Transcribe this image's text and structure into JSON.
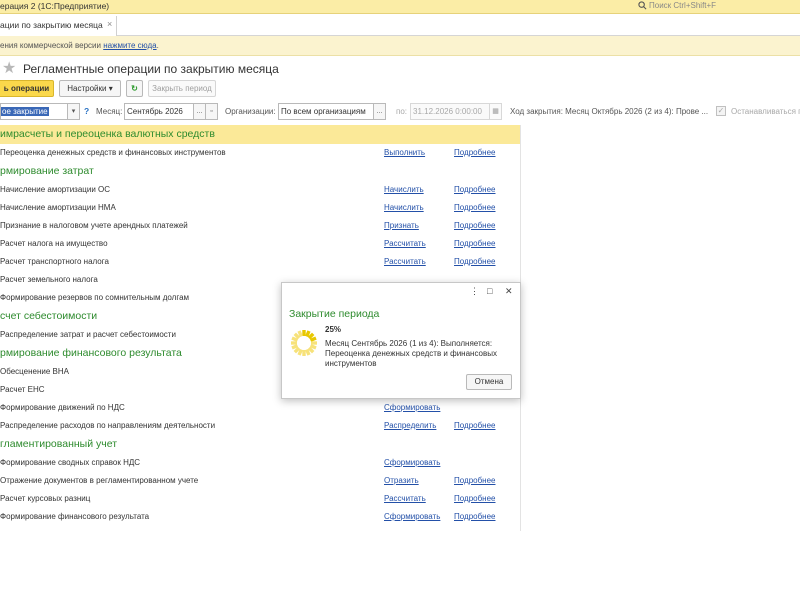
{
  "window": {
    "app_title": "ерация 2  (1С:Предприятие)",
    "search_placeholder": "Поиск Ctrl+Shift+F"
  },
  "tabs": [
    {
      "label": "ации по закрытию месяца",
      "close": "×"
    }
  ],
  "infobar": {
    "text": "ения коммерческой версии ",
    "link": "нажмите сюда",
    "suffix": "."
  },
  "form": {
    "title": "Регламентные операции по закрытию месяца"
  },
  "toolbar": {
    "primary_label": "ь операции",
    "settings_label": "Настройки",
    "settings_arrow": "▾",
    "refresh_icon": "↻",
    "close_period_label": "Закрыть период"
  },
  "filters": {
    "mode_value": "ое закрытие",
    "mode_arrow": "▾",
    "help": "?",
    "month_label": "Месяц:",
    "month_value": "Сентябрь 2026",
    "month_btn": "...",
    "month_btn2": "▫",
    "org_label": "Организации:",
    "org_value": "По всем организациям",
    "org_btn": "...",
    "to_label": "по:",
    "to_value": "31.12.2026  0:00:00",
    "to_btn": "▦",
    "progress_text": "Ход закрытия:  Месяц Октябрь 2026 (2 из 4): Прове ...",
    "stop_label": "Останавливаться при"
  },
  "groups": [
    {
      "label": "имрасчеты и переоценка валютных средств",
      "highlight": true,
      "rows": [
        {
          "label": "Переоценка денежных средств и финансовых инструментов",
          "action": "Выполнить",
          "more": "Подробнее"
        }
      ]
    },
    {
      "label": "рмирование затрат",
      "highlight": false,
      "rows": [
        {
          "label": "Начисление амортизации ОС",
          "action": "Начислить",
          "more": "Подробнее"
        },
        {
          "label": "Начисление амортизации НМА",
          "action": "Начислить",
          "more": "Подробнее"
        },
        {
          "label": "Признание в налоговом учете арендных платежей",
          "action": "Признать",
          "more": "Подробнее"
        },
        {
          "label": "Расчет налога на имущество",
          "action": "Рассчитать",
          "more": "Подробнее"
        },
        {
          "label": "Расчет транспортного налога",
          "action": "Рассчитать",
          "more": "Подробнее"
        },
        {
          "label": "Расчет земельного налога",
          "action": "",
          "more": ""
        },
        {
          "label": "Формирование резервов по сомнительным долгам",
          "action": "",
          "more": ""
        }
      ]
    },
    {
      "label": "счет себестоимости",
      "highlight": false,
      "rows": [
        {
          "label": "Распределение затрат и расчет себестоимости",
          "action": "",
          "more": ""
        }
      ]
    },
    {
      "label": "рмирование финансового результата",
      "highlight": false,
      "rows": [
        {
          "label": "Обесценение ВНА",
          "action": "",
          "more": ""
        },
        {
          "label": "Расчет ЕНС",
          "action": "",
          "more": ""
        },
        {
          "label": "Формирование движений по НДС",
          "action": "Сформировать",
          "more": ""
        },
        {
          "label": "Распределение расходов по направлениям деятельности",
          "action": "Распределить",
          "more": "Подробнее"
        }
      ]
    },
    {
      "label": "гламентированный учет",
      "highlight": false,
      "rows": [
        {
          "label": "Формирование сводных справок НДС",
          "action": "Сформировать",
          "more": ""
        },
        {
          "label": "Отражение документов в регламентированном учете",
          "action": "Отразить",
          "more": "Подробнее"
        },
        {
          "label": "Расчет курсовых разниц",
          "action": "Рассчитать",
          "more": "Подробнее"
        },
        {
          "label": "Формирование финансового результата",
          "action": "Сформировать",
          "more": "Подробнее"
        }
      ]
    }
  ],
  "dialog": {
    "more_icon": "⋮",
    "maximize_icon": "□",
    "close_icon": "✕",
    "title": "Закрытие периода",
    "percent": "25%",
    "progress_fraction": 0.25,
    "status": "Месяц Сентябрь 2026 (1 из 4): Выполняется: Переоценка денежных средств и финансовых инструментов",
    "cancel_label": "Отмена"
  },
  "colors": {
    "accent_yellow": "#fad84b",
    "group_green": "#2e8b2e",
    "link_blue": "#2350a8",
    "highlight_row": "#fbe998"
  }
}
